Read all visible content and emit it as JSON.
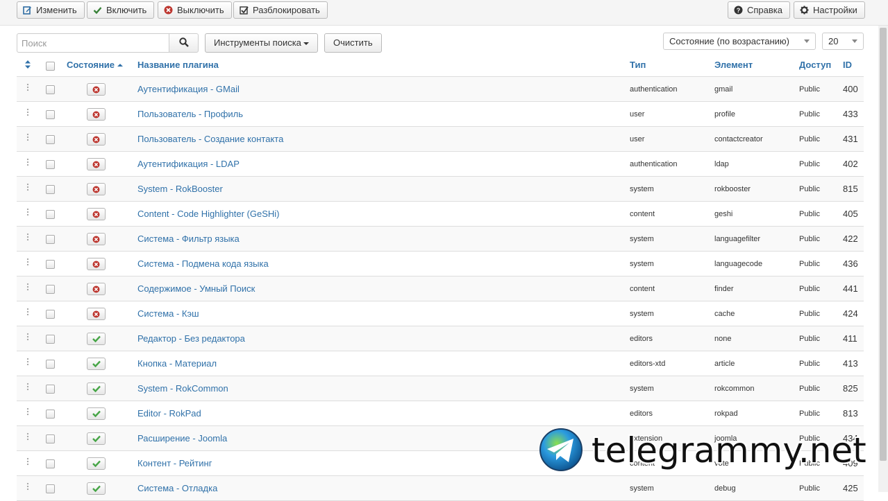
{
  "toolbar": {
    "edit_label": "Изменить",
    "enable_label": "Включить",
    "disable_label": "Выключить",
    "unlock_label": "Разблокировать",
    "help_label": "Справка",
    "settings_label": "Настройки"
  },
  "filters": {
    "search_placeholder": "Поиск",
    "search_tools_label": "Инструменты поиска",
    "clear_label": "Очистить",
    "sort_value": "Состояние (по возрастанию)",
    "limit_value": "20"
  },
  "table": {
    "headers": {
      "status": "Состояние",
      "name": "Название плагина",
      "type": "Тип",
      "element": "Элемент",
      "access": "Доступ",
      "id": "ID"
    },
    "rows": [
      {
        "enabled": false,
        "name": "Аутентификация - GMail",
        "type": "authentication",
        "element": "gmail",
        "access": "Public",
        "id": "400"
      },
      {
        "enabled": false,
        "name": "Пользователь - Профиль",
        "type": "user",
        "element": "profile",
        "access": "Public",
        "id": "433"
      },
      {
        "enabled": false,
        "name": "Пользователь - Создание контакта",
        "type": "user",
        "element": "contactcreator",
        "access": "Public",
        "id": "431"
      },
      {
        "enabled": false,
        "name": "Аутентификация - LDAP",
        "type": "authentication",
        "element": "ldap",
        "access": "Public",
        "id": "402"
      },
      {
        "enabled": false,
        "name": "System - RokBooster",
        "type": "system",
        "element": "rokbooster",
        "access": "Public",
        "id": "815"
      },
      {
        "enabled": false,
        "name": "Content - Code Highlighter (GeSHi)",
        "type": "content",
        "element": "geshi",
        "access": "Public",
        "id": "405"
      },
      {
        "enabled": false,
        "name": "Система - Фильтр языка",
        "type": "system",
        "element": "languagefilter",
        "access": "Public",
        "id": "422"
      },
      {
        "enabled": false,
        "name": "Система - Подмена кода языка",
        "type": "system",
        "element": "languagecode",
        "access": "Public",
        "id": "436"
      },
      {
        "enabled": false,
        "name": "Содержимое - Умный Поиск",
        "type": "content",
        "element": "finder",
        "access": "Public",
        "id": "441"
      },
      {
        "enabled": false,
        "name": "Система - Кэш",
        "type": "system",
        "element": "cache",
        "access": "Public",
        "id": "424"
      },
      {
        "enabled": true,
        "name": "Редактор - Без редактора",
        "type": "editors",
        "element": "none",
        "access": "Public",
        "id": "411"
      },
      {
        "enabled": true,
        "name": "Кнопка - Материал",
        "type": "editors-xtd",
        "element": "article",
        "access": "Public",
        "id": "413"
      },
      {
        "enabled": true,
        "name": "System - RokCommon",
        "type": "system",
        "element": "rokcommon",
        "access": "Public",
        "id": "825"
      },
      {
        "enabled": true,
        "name": "Editor - RokPad",
        "type": "editors",
        "element": "rokpad",
        "access": "Public",
        "id": "813"
      },
      {
        "enabled": true,
        "name": "Расширение - Joomla",
        "type": "extension",
        "element": "joomla",
        "access": "Public",
        "id": "434"
      },
      {
        "enabled": true,
        "name": "Контент - Рейтинг",
        "type": "content",
        "element": "vote",
        "access": "Public",
        "id": "409"
      },
      {
        "enabled": true,
        "name": "Система - Отладка",
        "type": "system",
        "element": "debug",
        "access": "Public",
        "id": "425"
      }
    ]
  },
  "watermark": {
    "text": "telegrammy.net"
  }
}
